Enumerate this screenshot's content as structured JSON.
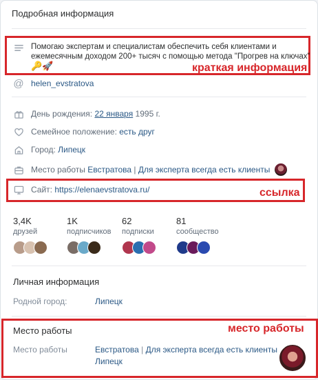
{
  "header": {
    "title": "Подробная информация"
  },
  "about": {
    "text_line1": "Помогаю экспертам и специалистам обеспечить себя клиентами и",
    "text_line2": "ежемесячным доходом 200+ тысяч с помощью метода \"Прогрев на ключах\"",
    "emoji": "🔑🚀"
  },
  "annotations": {
    "about": "краткая информация",
    "site": "ссылка",
    "work": "место работы"
  },
  "username": "helen_evstratova",
  "details": {
    "birthday_label": "День рождения:",
    "birthday_date": "22 января",
    "birthday_year": "1995 г.",
    "family_label": "Семейное положение:",
    "family_value": "есть друг",
    "city_label": "Город:",
    "city_value": "Липецк",
    "work_label": "Место работы",
    "work_name": "Евстратова",
    "work_sep": "|",
    "work_group": "Для эксперта всегда есть клиенты",
    "site_label": "Сайт:",
    "site_value": "https://elenaevstratova.ru/"
  },
  "stats": [
    {
      "count": "3,4K",
      "label": "друзей"
    },
    {
      "count": "1K",
      "label": "подписчиков"
    },
    {
      "count": "62",
      "label": "подписки"
    },
    {
      "count": "81",
      "label": "сообщество"
    }
  ],
  "personal": {
    "title": "Личная информация",
    "hometown_label": "Родной город:",
    "hometown_value": "Липецк"
  },
  "work": {
    "title": "Место работы",
    "label": "Место работы",
    "name": "Евстратова",
    "sep": "|",
    "group": "Для эксперта всегда есть клиенты",
    "city": "Липецк"
  },
  "colors": {
    "accent": "#2a5885",
    "annotation": "#d7262a",
    "icon": "#99a2ad"
  }
}
